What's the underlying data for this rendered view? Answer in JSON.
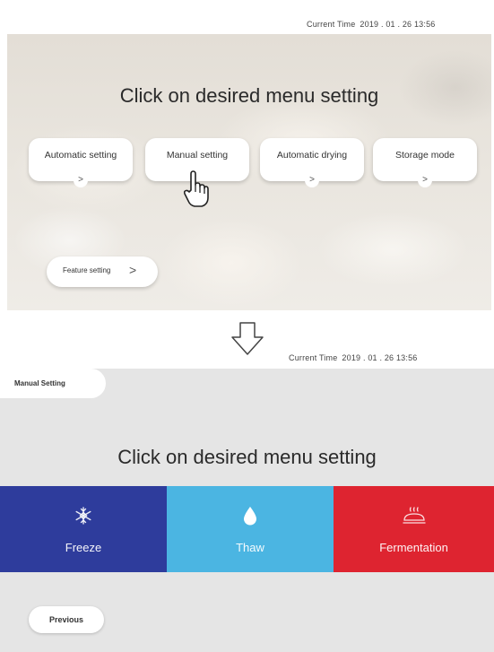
{
  "screen1": {
    "current_time_label": "Current Time",
    "current_time_value": "2019 . 01 . 26 13:56",
    "title": "Click on desired menu setting",
    "menu_buttons": [
      {
        "label": "Automatic setting",
        "chevron": ">"
      },
      {
        "label": "Manual setting",
        "chevron": ">"
      },
      {
        "label": "Automatic drying",
        "chevron": ">"
      },
      {
        "label": "Storage mode",
        "chevron": ">"
      }
    ],
    "feature_button": {
      "label": "Feature setting",
      "chevron": ">"
    },
    "pointer_icon": "hand-pointer-icon"
  },
  "transition_icon": "down-arrow-icon",
  "screen2": {
    "current_time_label": "Current Time",
    "current_time_value": "2019 . 01 . 26 13:56",
    "tag": "Manual Setting",
    "title": "Click on desired menu setting",
    "tiles": [
      {
        "label": "Freeze",
        "icon": "snowflake-icon",
        "color": "#2e3c9c"
      },
      {
        "label": "Thaw",
        "icon": "water-drop-icon",
        "color": "#4bb5e2"
      },
      {
        "label": "Fermentation",
        "icon": "bread-icon",
        "color": "#de2430"
      }
    ],
    "previous_button": "Previous"
  }
}
